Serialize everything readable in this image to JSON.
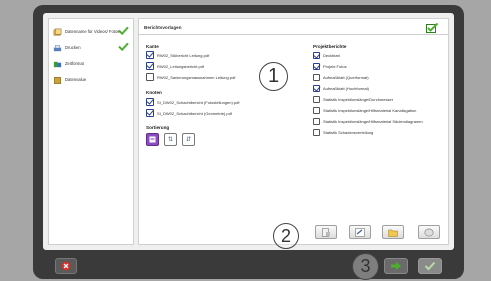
{
  "sidebar": {
    "items": [
      {
        "label": "Datenname für Videos/ Fotos",
        "icon": "photo-stack-icon",
        "done": true
      },
      {
        "label": "Drucken",
        "icon": "printer-icon",
        "done": true
      },
      {
        "label": "Zeitformat",
        "icon": "format-icon",
        "done": false
      },
      {
        "label": "Datenvalue",
        "icon": "data-icon",
        "done": false
      }
    ]
  },
  "main": {
    "title": "Berichtsvorlagen",
    "kante": {
      "heading": "Kante",
      "items": [
        {
          "label": "RW02_Stübericht Leitung.pdf",
          "checked": true
        },
        {
          "label": "RW02_Leitungsbericht.pdf",
          "checked": true
        },
        {
          "label": "RW02_Sanierungsmassnahmen Leitung.pdf",
          "checked": false
        }
      ]
    },
    "knoten": {
      "heading": "Knoten",
      "items": [
        {
          "label": "SI_DW02_Schachtbericht (Fotostellungen).pdf",
          "checked": true
        },
        {
          "label": "SI_DW02_Schachtbericht (Geometrie).pdf",
          "checked": true
        }
      ]
    },
    "sortierung": {
      "heading": "Sortierung",
      "buttons": [
        "≡",
        "⇅",
        "⇵"
      ]
    },
    "projekt": {
      "heading": "Projektberichte",
      "items": [
        {
          "label": "Deckblatt",
          "checked": true
        },
        {
          "label": "Projekt Fotos",
          "checked": true
        },
        {
          "label": "Aufmaßblatt (Querformat)",
          "checked": false
        },
        {
          "label": "Aufmaßblatt (Hochformat)",
          "checked": true
        },
        {
          "label": "Statistik Inspektionslänge/Durchmesser",
          "checked": false
        },
        {
          "label": "Statistik Inspektionslänge/Hilfsmaterial Kanalisgation",
          "checked": false
        },
        {
          "label": "Statistik Inspektionslänge/Hilfsmaterial Säulendiagramm",
          "checked": false
        },
        {
          "label": "Statistik Schadensverteilung",
          "checked": false
        }
      ]
    }
  },
  "callouts": [
    "1",
    "2",
    "3"
  ],
  "colors": {
    "accent_green": "#4caf2e",
    "accent_purple": "#8a4cc0",
    "danger_red": "#d0302a"
  }
}
